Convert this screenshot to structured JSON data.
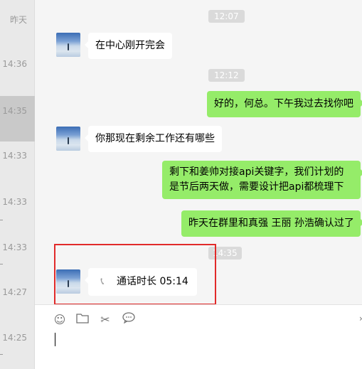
{
  "sidebar": {
    "times": [
      "昨天",
      "14:36",
      "14:35",
      "14:33",
      "14:33",
      "14:33",
      "14:27",
      "14:25"
    ]
  },
  "chat": {
    "time_markers": [
      "12:07",
      "12:12",
      "14:35"
    ],
    "messages": [
      {
        "side": "in",
        "text": "在中心刚开完会"
      },
      {
        "side": "out",
        "text": "好的，何总。下午我过去找你吧"
      },
      {
        "side": "in",
        "text": "你那现在剩余工作还有哪些"
      },
      {
        "side": "out",
        "text": "剩下和姜帅对接api关键字，我们计划的是节后两天做，需要设计把api都梳理下"
      },
      {
        "side": "out",
        "text": "昨天在群里和真强 王丽 孙浩确认过了"
      },
      {
        "side": "in",
        "type": "call",
        "icon": "phone-icon",
        "text": "通话时长 05:14"
      }
    ]
  },
  "toolbar": {
    "emoji_icon": "☺",
    "folder_icon": "folder",
    "scissors_icon": "✂",
    "chat_icon": "speech-bubble"
  },
  "colors": {
    "outgoing_bubble": "#95ec69",
    "incoming_bubble": "#ffffff",
    "highlight": "#e12a2a"
  }
}
